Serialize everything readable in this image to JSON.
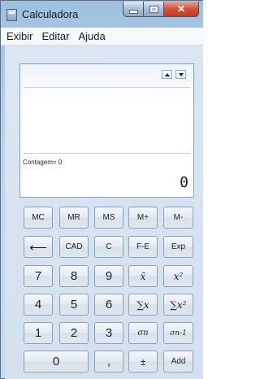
{
  "window": {
    "title": "Calculadora"
  },
  "menu": {
    "items": [
      "Exibir",
      "Editar",
      "Ajuda"
    ]
  },
  "display": {
    "count_label": "Contagem= 0",
    "value": "0"
  },
  "keys": {
    "mc": "MC",
    "mr": "MR",
    "ms": "MS",
    "mplus": "M+",
    "mminus": "M-",
    "back": "⟵",
    "cad": "CAD",
    "c": "C",
    "fe": "F-E",
    "exp": "Exp",
    "d7": "7",
    "d8": "8",
    "d9": "9",
    "mean": "x̄",
    "meansq": "x²",
    "d4": "4",
    "d5": "5",
    "d6": "6",
    "sum": "∑x",
    "sumsq": "∑x²",
    "d1": "1",
    "d2": "2",
    "d3": "3",
    "sigman": "σn",
    "sigman1": "σn-1",
    "d0": "0",
    "comma": ",",
    "plusminus": "±",
    "add": "Add"
  }
}
